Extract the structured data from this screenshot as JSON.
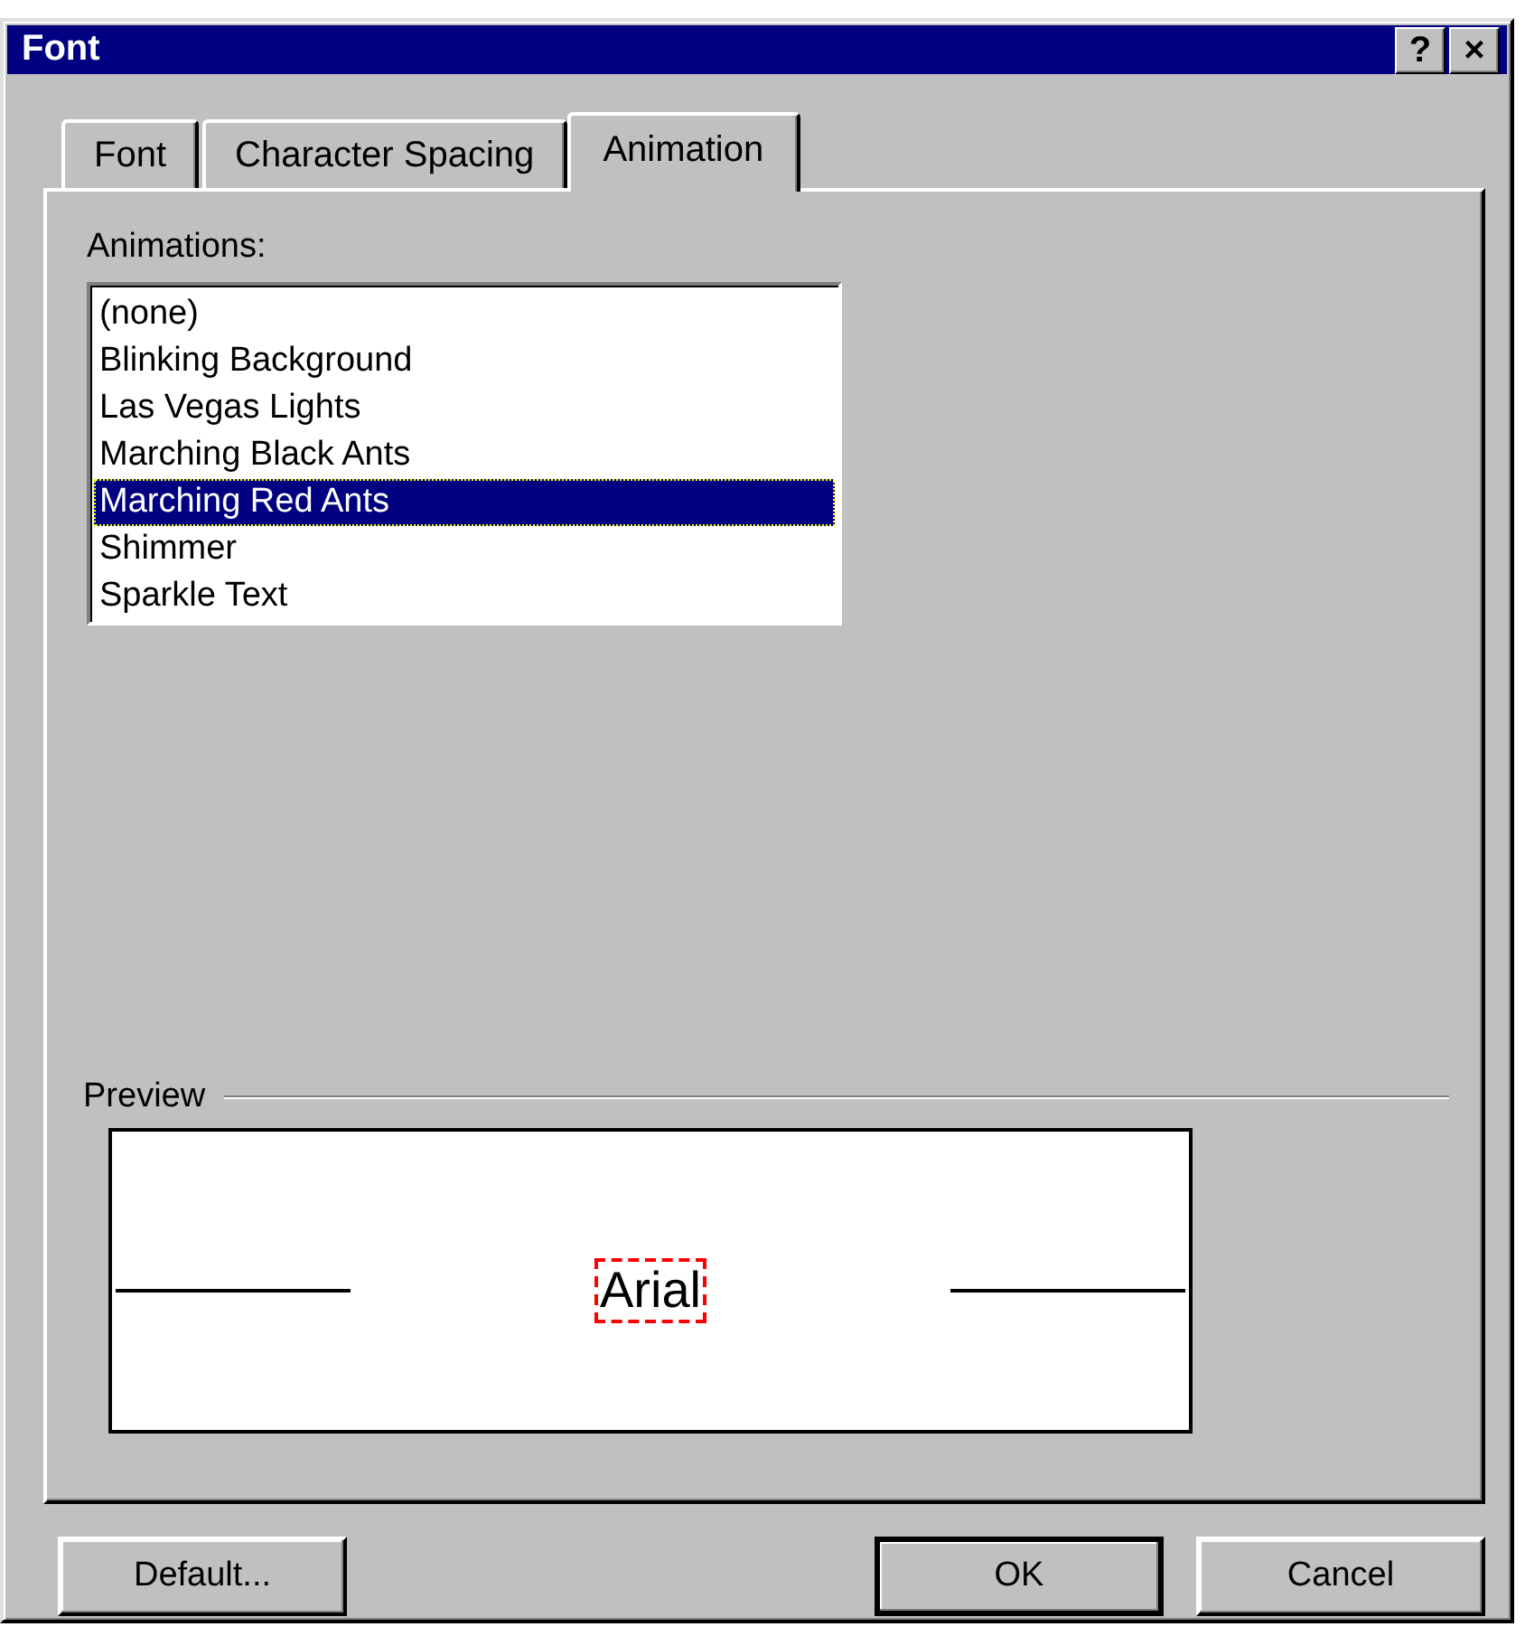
{
  "window": {
    "title": "Font",
    "help_button": "?",
    "close_button": "×"
  },
  "tabs": [
    {
      "label": "Font",
      "selected": false
    },
    {
      "label": "Character Spacing",
      "selected": false
    },
    {
      "label": "Animation",
      "selected": true
    }
  ],
  "animations": {
    "label": "Animations:",
    "items": [
      {
        "label": "(none)",
        "selected": false
      },
      {
        "label": "Blinking Background",
        "selected": false
      },
      {
        "label": "Las Vegas Lights",
        "selected": false
      },
      {
        "label": "Marching Black Ants",
        "selected": false
      },
      {
        "label": "Marching Red Ants",
        "selected": true
      },
      {
        "label": "Shimmer",
        "selected": false
      },
      {
        "label": "Sparkle Text",
        "selected": false
      }
    ]
  },
  "preview": {
    "label": "Preview",
    "sample": "Arial"
  },
  "buttons": [
    {
      "label": "Default...",
      "default": false
    },
    {
      "label": "OK",
      "default": true
    },
    {
      "label": "Cancel",
      "default": false
    }
  ]
}
